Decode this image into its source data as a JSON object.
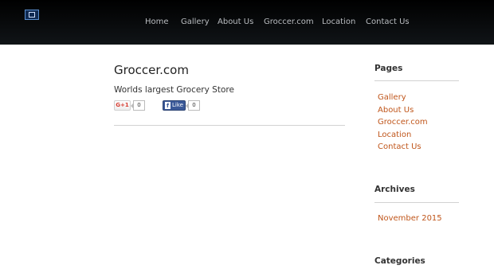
{
  "nav": {
    "items": [
      "Home",
      "Gallery",
      "About Us",
      "Groccer.com",
      "Location",
      "Contact Us"
    ]
  },
  "post": {
    "title": "Groccer.com",
    "tagline": "Worlds largest Grocery Store"
  },
  "social": {
    "gplus_label": "G+1",
    "gplus_count": "0",
    "fb_glyph": "f",
    "fb_label": "Like",
    "fb_count": "0"
  },
  "sidebar": {
    "pages": {
      "title": "Pages",
      "items": [
        "Gallery",
        "About Us",
        "Groccer.com",
        "Location",
        "Contact Us"
      ]
    },
    "archives": {
      "title": "Archives",
      "items": [
        "November 2015"
      ]
    },
    "categories": {
      "title": "Categories"
    }
  },
  "colors": {
    "header_bg": "#0b0e10",
    "link": "#c0561b",
    "nav_text": "#b9bcc0",
    "facebook": "#3b5998"
  }
}
